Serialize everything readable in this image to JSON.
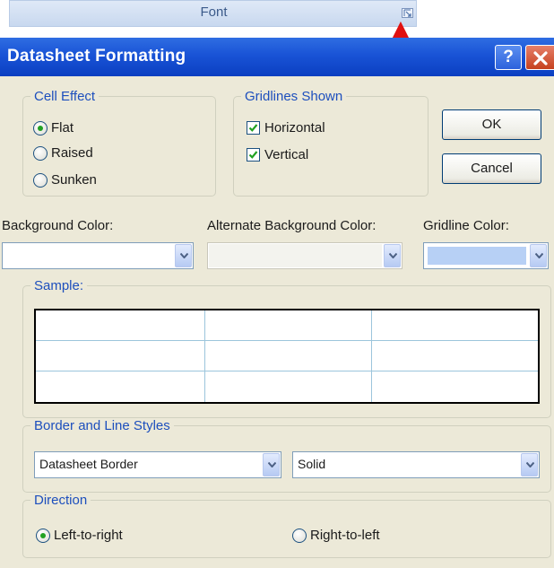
{
  "ribbon": {
    "group_label": "Font",
    "launcher_icon": "dialog-launcher-icon"
  },
  "annotation": {
    "arrow_color": "#e01010"
  },
  "dialog": {
    "title": "Datasheet Formatting",
    "help_label": "?",
    "cell_effect": {
      "legend": "Cell Effect",
      "options": [
        {
          "label": "Flat",
          "selected": true
        },
        {
          "label": "Raised",
          "selected": false
        },
        {
          "label": "Sunken",
          "selected": false
        }
      ]
    },
    "gridlines": {
      "legend": "Gridlines Shown",
      "options": [
        {
          "label": "Horizontal",
          "checked": true
        },
        {
          "label": "Vertical",
          "checked": true
        }
      ]
    },
    "ok_label": "OK",
    "cancel_label": "Cancel",
    "background_color": {
      "label": "Background Color:",
      "value": "#ffffff"
    },
    "alternate_background_color": {
      "label": "Alternate Background Color:",
      "value": "#f3f3ee"
    },
    "gridline_color": {
      "label": "Gridline Color:",
      "value": "#b7d0f5"
    },
    "sample": {
      "legend": "Sample:",
      "rows": 3,
      "columns": 3
    },
    "border_styles": {
      "legend": "Border and Line Styles",
      "border_select": "Datasheet Border",
      "line_style_select": "Solid"
    },
    "direction": {
      "legend": "Direction",
      "options": [
        {
          "label": "Left-to-right",
          "selected": true
        },
        {
          "label": "Right-to-left",
          "selected": false
        }
      ]
    }
  }
}
